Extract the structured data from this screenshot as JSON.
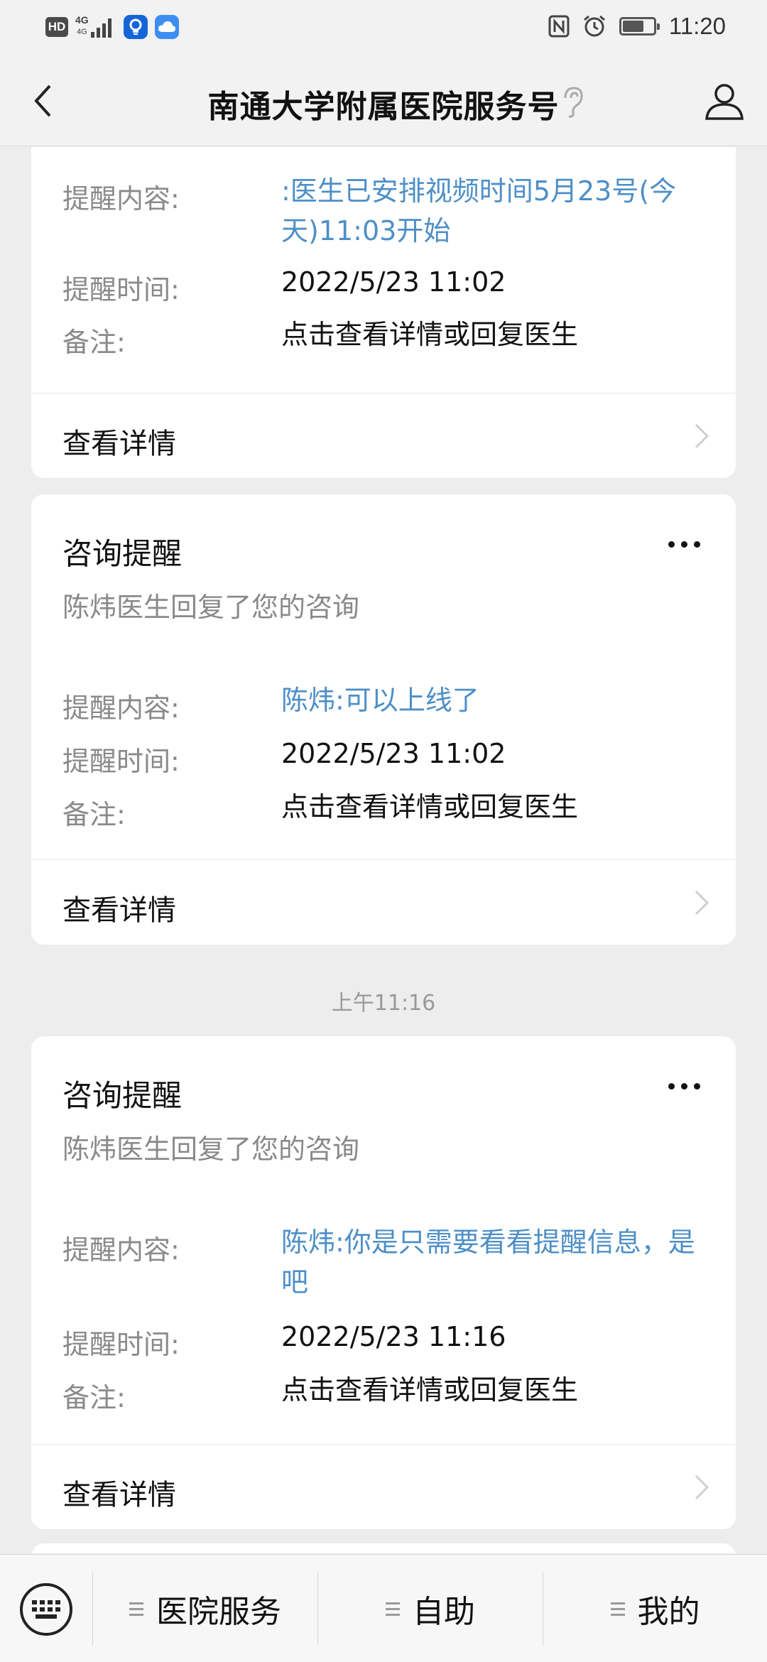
{
  "status_bar": {
    "hd_badge": "HD",
    "network": "4G",
    "network_sub": "4G",
    "time": "11:20",
    "battery_level": 0.7,
    "icons": [
      "hd-icon",
      "signal-icon",
      "bulb-app-icon",
      "cloud-app-icon",
      "nfc-icon",
      "alarm-icon",
      "battery-icon"
    ]
  },
  "nav": {
    "title": "南通大学附属医院服务号",
    "icons": [
      "back-icon",
      "ear-icon",
      "profile-icon"
    ]
  },
  "messages": [
    {
      "partial": true,
      "fields": [
        {
          "label": "提醒内容:",
          "value": ":医生已安排视频时间5月23号(今天)11:03开始",
          "link": true
        },
        {
          "label": "提醒时间:",
          "value": "2022/5/23 11:02",
          "link": false
        },
        {
          "label": "备注:",
          "value": "点击查看详情或回复医生",
          "link": false
        }
      ],
      "detail_label": "查看详情"
    },
    {
      "title": "咨询提醒",
      "subtitle": "陈炜医生回复了您的咨询",
      "fields": [
        {
          "label": "提醒内容:",
          "value": "陈炜:可以上线了",
          "link": true
        },
        {
          "label": "提醒时间:",
          "value": "2022/5/23 11:02",
          "link": false
        },
        {
          "label": "备注:",
          "value": "点击查看详情或回复医生",
          "link": false
        }
      ],
      "detail_label": "查看详情"
    },
    {
      "title": "咨询提醒",
      "subtitle": "陈炜医生回复了您的咨询",
      "fields": [
        {
          "label": "提醒内容:",
          "value": "陈炜:你是只需要看看提醒信息，是吧",
          "link": true
        },
        {
          "label": "提醒时间:",
          "value": "2022/5/23 11:16",
          "link": false
        },
        {
          "label": "备注:",
          "value": "点击查看详情或回复医生",
          "link": false
        }
      ],
      "detail_label": "查看详情"
    }
  ],
  "time_separator": "上午11:16",
  "bottom_menu": {
    "items": [
      {
        "label": "医院服务"
      },
      {
        "label": "自助"
      },
      {
        "label": "我的"
      }
    ]
  },
  "colors": {
    "link": "#4e8fc7",
    "background": "#ededed",
    "card": "#ffffff",
    "muted": "#8a8a8a"
  }
}
